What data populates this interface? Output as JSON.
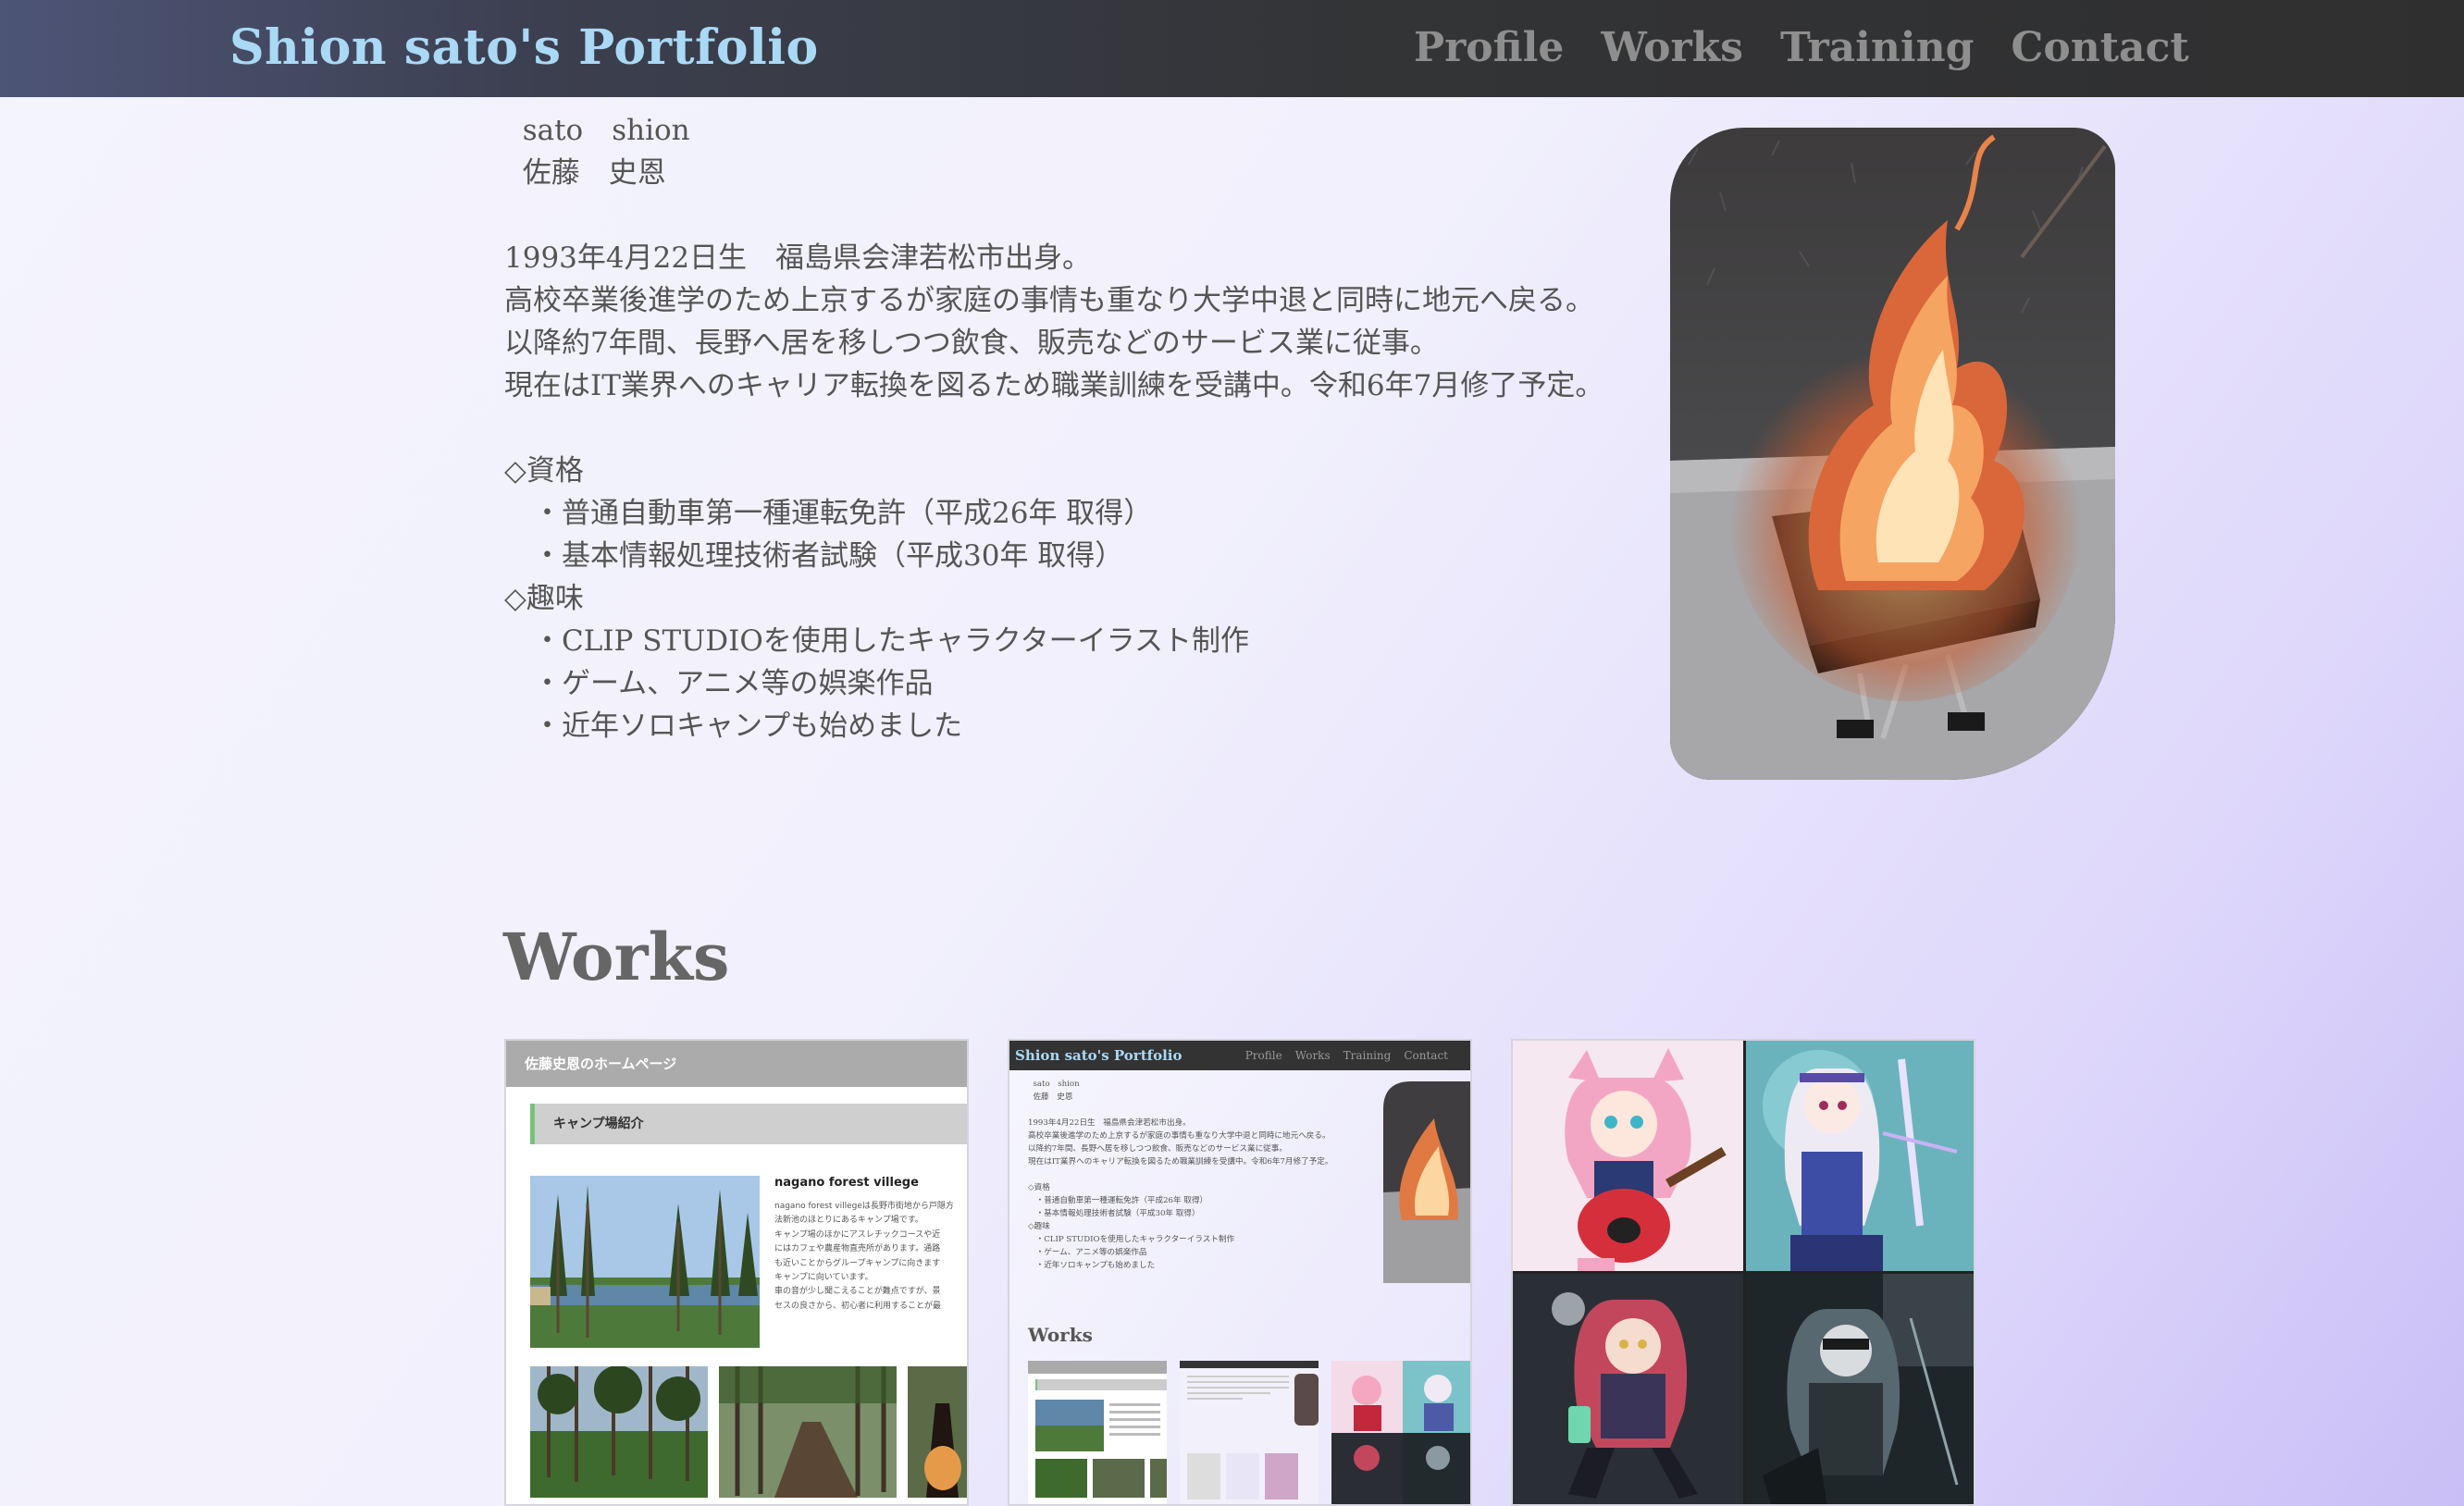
{
  "header": {
    "brand": "Shion sato's Portfolio",
    "nav": [
      "Profile",
      "Works",
      "Training",
      "Contact"
    ]
  },
  "profile": {
    "lines": [
      "  sato　shion",
      "  佐藤　史恩",
      "",
      "1993年4月22日生　福島県会津若松市出身。",
      "高校卒業後進学のため上京するが家庭の事情も重なり大学中退と同時に地元へ戻る。",
      "以降約7年間、長野へ居を移しつつ飲食、販売などのサービス業に従事。",
      "現在はIT業界へのキャリア転換を図るため職業訓練を受講中。令和6年7月修了予定。",
      "",
      "◇資格",
      "　・普通自動車第一種運転免許（平成26年 取得）",
      "　・基本情報処理技術者試験（平成30年 取得）",
      "◇趣味",
      "　・CLIP STUDIOを使用したキャラクターイラスト制作",
      "　・ゲーム、アニメ等の娯楽作品",
      "　・近年ソロキャンプも始めました"
    ]
  },
  "works": {
    "heading": "Works",
    "card1": {
      "site_title": "佐藤史恩のホームページ",
      "section": "キャンプ場紹介",
      "venue_title": "nagano forest villege",
      "venue_text": [
        "nagano forest villegeは長野市街地から戸隠方",
        "法新池のほとりにあるキャンプ場です。",
        "キャンプ場のほかにアスレチックコースや近",
        "にはカフェや農産物直売所があります。通路",
        "も近いことからグループキャンプに向きます",
        "キャンプに向いています。",
        "車の音が少し聞こえることが難点ですが、景",
        "セスの良さから、初心者に利用することが最"
      ]
    },
    "card2": {
      "brand": "Shion sato's Portfolio",
      "nav": [
        "Profile",
        "Works",
        "Training",
        "Contact"
      ],
      "profile_lines": [
        "  sato　shion",
        "  佐藤　史恩",
        "",
        "1993年4月22日生　福島県会津若松市出身。",
        "高校卒業後進学のため上京するが家庭の事情も重なり大学中退と同時に地元へ戻る。",
        "以降約7年間、長野へ居を移しつつ飲食、販売などのサービス業に従事。",
        "現在はIT業界へのキャリア転換を図るため職業訓練を受講中。令和6年7月修了予定。",
        "",
        "◇資格",
        "　・普通自動車第一種運転免許（平成26年 取得）",
        "　・基本情報処理技術者試験（平成30年 取得）",
        "◇趣味",
        "　・CLIP STUDIOを使用したキャラクターイラスト制作",
        "　・ゲーム、アニメ等の娯楽作品",
        "　・近年ソロキャンプも始めました"
      ],
      "works_heading": "Works"
    }
  },
  "colors": {
    "brand": "#a9d9f5",
    "nav": "#8e8e8e",
    "header_bg": "#2f2f30",
    "text": "#555555"
  }
}
